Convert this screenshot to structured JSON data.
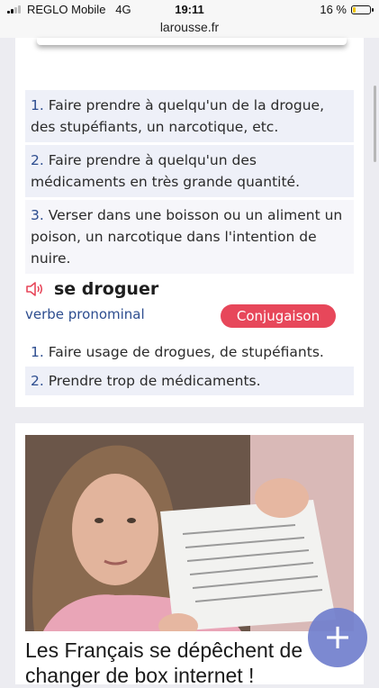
{
  "status_bar": {
    "carrier": "REGLO Mobile",
    "network": "4G",
    "time": "19:11",
    "battery": "16 %",
    "battery_level": 0.16
  },
  "browser": {
    "url": "larousse.fr"
  },
  "definitions_a": [
    {
      "num": "1.",
      "text": " Faire prendre à quelqu'un de la drogue, des stupéfiants, un narcotique, etc."
    },
    {
      "num": "2.",
      "text": " Faire prendre à quelqu'un des médicaments en très grande quantité."
    },
    {
      "num": "3.",
      "text": " Verser dans une boisson ou un aliment un poison, un narcotique dans l'intention de nuire."
    }
  ],
  "entry": {
    "icon": "speaker-icon",
    "title": "se droguer",
    "part_of_speech": "verbe pronominal",
    "conjugation_label": "Conjugaison"
  },
  "definitions_b": [
    {
      "num": "1.",
      "text": " Faire usage de drogues, de stupéfiants."
    },
    {
      "num": "2.",
      "text": " Prendre trop de médicaments."
    }
  ],
  "ad": {
    "title": "Les Français se dépêchent de changer de box internet !"
  },
  "fab": {
    "icon": "plus-icon",
    "label": "+"
  },
  "colors": {
    "accent_blue": "#2d4d8f",
    "button_red": "#e7475a",
    "fab_blue": "#717fcd"
  }
}
